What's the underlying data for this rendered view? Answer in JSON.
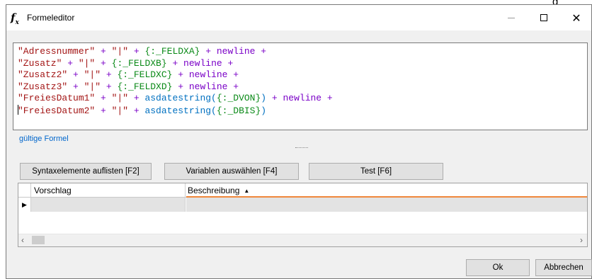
{
  "top_clipped_char": "g",
  "window": {
    "title": "Formeleditor",
    "icon": "fx-icon",
    "controls": {
      "minimize": "minimize-icon",
      "maximize": "maximize-icon",
      "close": "close-icon"
    }
  },
  "editor": {
    "lines": [
      [
        [
          "str",
          "\"Adressnummer\""
        ],
        [
          "op",
          " + "
        ],
        [
          "str",
          "\"|\""
        ],
        [
          "op",
          " + "
        ],
        [
          "var",
          "{:_FELDXA}"
        ],
        [
          "op",
          " + newline +"
        ]
      ],
      [
        [
          "str",
          "\"Zusatz\""
        ],
        [
          "op",
          " + "
        ],
        [
          "str",
          "\"|\""
        ],
        [
          "op",
          " + "
        ],
        [
          "var",
          "{:_FELDXB}"
        ],
        [
          "op",
          " + newline +"
        ]
      ],
      [
        [
          "str",
          "\"Zusatz2\""
        ],
        [
          "op",
          " + "
        ],
        [
          "str",
          "\"|\""
        ],
        [
          "op",
          " + "
        ],
        [
          "var",
          "{:_FELDXC}"
        ],
        [
          "op",
          " + newline +"
        ]
      ],
      [
        [
          "str",
          "\"Zusatz3\""
        ],
        [
          "op",
          " + "
        ],
        [
          "str",
          "\"|\""
        ],
        [
          "op",
          " + "
        ],
        [
          "var",
          "{:_FELDXD}"
        ],
        [
          "op",
          " + newline +"
        ]
      ],
      [
        [
          "str",
          "\"FreiesDatum1\""
        ],
        [
          "op",
          " + "
        ],
        [
          "str",
          "\"|\""
        ],
        [
          "op",
          " + "
        ],
        [
          "fn",
          "asdatestring("
        ],
        [
          "var",
          "{:_DVON}"
        ],
        [
          "fn",
          ")"
        ],
        [
          "op",
          " + newline +"
        ]
      ],
      [
        [
          "caret",
          ""
        ],
        [
          "str",
          "\"FreiesDatum2\""
        ],
        [
          "op",
          " + "
        ],
        [
          "str",
          "\"|\""
        ],
        [
          "op",
          " + "
        ],
        [
          "fn",
          "asdatestring("
        ],
        [
          "var",
          "{:_DBIS}"
        ],
        [
          "fn",
          ")"
        ]
      ]
    ]
  },
  "status_text": "gültige Formel",
  "buttons": {
    "syntax": "Syntaxelemente auflisten [F2]",
    "variables": "Variablen auswählen [F4]",
    "test": "Test [F6]",
    "ok": "Ok",
    "cancel": "Abbrechen"
  },
  "grid": {
    "columns": [
      "Vorschlag",
      "Beschreibung"
    ],
    "sort_column": "Beschreibung",
    "sort_direction": "ascending",
    "rows": [
      {
        "Vorschlag": "",
        "Beschreibung": ""
      }
    ]
  }
}
